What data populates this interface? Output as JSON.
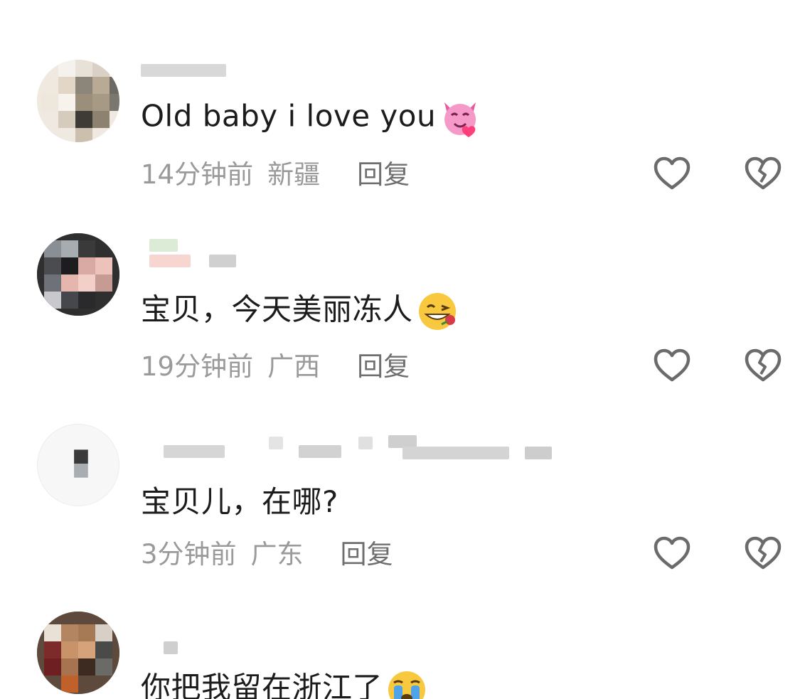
{
  "comments": [
    {
      "avatar_icon": "blurred-avatar",
      "username": "",
      "text": "Old baby i love you",
      "emoji": "smiling-imp-heart-emoji",
      "time": "14分钟前",
      "region": "新疆",
      "reply_label": "回复",
      "like_icon": "heart-outline-icon",
      "dislike_icon": "broken-heart-icon"
    },
    {
      "avatar_icon": "blurred-avatar",
      "username": "",
      "text": "宝贝，今天美丽冻人",
      "emoji": "winking-face-rose-emoji",
      "time": "19分钟前",
      "region": "广西",
      "reply_label": "回复",
      "like_icon": "heart-outline-icon",
      "dislike_icon": "broken-heart-icon"
    },
    {
      "avatar_icon": "blurred-avatar",
      "username": "",
      "text": "宝贝儿，在哪?",
      "emoji": "",
      "time": "3分钟前",
      "region": "广东",
      "reply_label": "回复",
      "like_icon": "heart-outline-icon",
      "dislike_icon": "broken-heart-icon"
    },
    {
      "avatar_icon": "blurred-avatar",
      "username": "",
      "text": "你把我留在浙江了",
      "emoji": "crying-face-emoji",
      "time": "",
      "region": "",
      "reply_label": "",
      "like_icon": "",
      "dislike_icon": ""
    }
  ],
  "colors": {
    "meta_text": "#9a9a9a",
    "reply_text": "#6f6f6f",
    "icon_stroke": "#6b6b6b"
  }
}
